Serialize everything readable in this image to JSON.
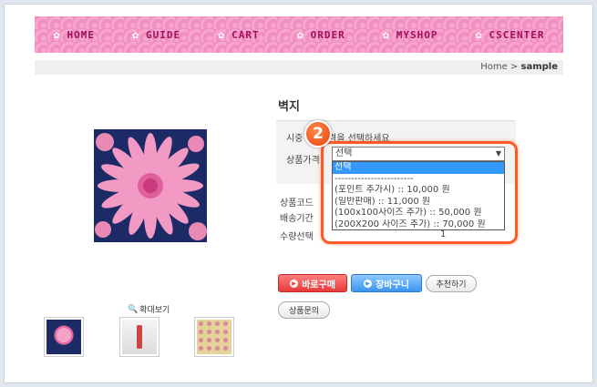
{
  "nav": {
    "items": [
      {
        "label": "HOME"
      },
      {
        "label": "GUIDE"
      },
      {
        "label": "CART"
      },
      {
        "label": "ORDER"
      },
      {
        "label": "MYSHOP"
      },
      {
        "label": "CSCENTER"
      }
    ]
  },
  "breadcrumb": {
    "home": "Home",
    "separator": ">",
    "current": "sample"
  },
  "product": {
    "title": "벽지",
    "notice_prefix": "시중",
    "notice_suffix": "격을 선택하세요",
    "price_label": "상품가격",
    "code_label": "상품코드",
    "delivery_label": "배송기간",
    "qty_label": "수량선택",
    "qty_value": "1"
  },
  "option_select": {
    "value": "선택",
    "options": [
      {
        "label": "선택",
        "selected": true
      },
      {
        "label": "------------------------"
      },
      {
        "label": "(포인트 추가시) :: 10,000 원"
      },
      {
        "label": "(일반판매) :: 11,000 원"
      },
      {
        "label": "(100x100사이즈 추가) :: 50,000 원"
      },
      {
        "label": "(200X200 사이즈 추가) :: 70,000 원"
      }
    ]
  },
  "callout": {
    "number": "2",
    "color": "#ff5a24"
  },
  "gallery": {
    "zoom_label": "확대보기"
  },
  "buttons": {
    "buy": "바로구매",
    "cart": "장바구니",
    "recommend": "추천하기",
    "inquiry": "상품문의"
  },
  "colors": {
    "nav_bg": "#f49ac6",
    "nav_text": "#a0105c",
    "buy": "#e63b3b",
    "cart": "#3a96f0"
  }
}
